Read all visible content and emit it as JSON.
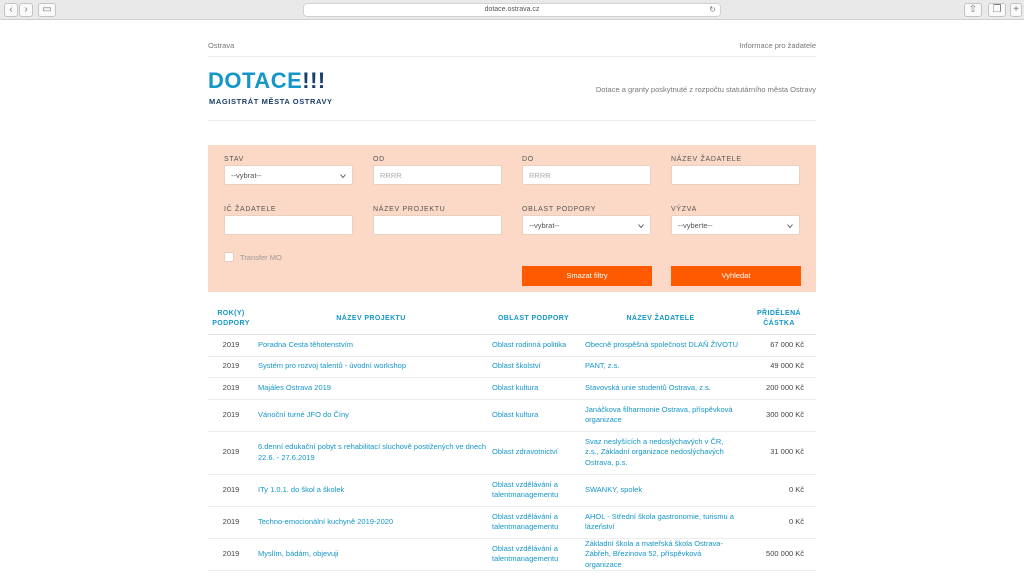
{
  "browser": {
    "url": "dotace.ostrava.cz"
  },
  "topbar": {
    "left": "Ostrava",
    "right": "Informace pro žadatele"
  },
  "header": {
    "logo_word": "DOTACE",
    "logo_bangs": "!!!",
    "logo_sub": "MAGISTRÁT MĚSTA OSTRAVY",
    "tagline": "Dotace a granty poskytnuté z rozpočtu statutárního města Ostravy"
  },
  "filters": {
    "stav": {
      "label": "STAV",
      "value": "--vybrat--"
    },
    "od": {
      "label": "OD",
      "placeholder": "RRRR"
    },
    "do": {
      "label": "DO",
      "placeholder": "RRRR"
    },
    "nazev_zadatele": {
      "label": "NÁZEV ŽADATELE",
      "value": ""
    },
    "ic_zadatele": {
      "label": "IČ ŽADATELE",
      "value": ""
    },
    "nazev_projektu": {
      "label": "NÁZEV PROJEKTU",
      "value": ""
    },
    "oblast_podpory": {
      "label": "OBLAST PODPORY",
      "value": "--vybrat--"
    },
    "vyzva": {
      "label": "VÝZVA",
      "value": "--vyberte--"
    },
    "transfer_label": "Transfer MO",
    "clear_label": "Smazat filtry",
    "search_label": "Vyhledat"
  },
  "table": {
    "headers": [
      "ROK(Y)\nPODPORY",
      "NÁZEV PROJEKTU",
      "OBLAST PODPORY",
      "NÁZEV ŽADATELE",
      "PŘIDĚLENÁ\nČÁSTKA"
    ],
    "rows": [
      {
        "year": "2019",
        "project": "Poradna Cesta těhotenstvím",
        "area": "Oblast rodinná politika",
        "applicant": "Obecně prospěšná společnost DLAŇ ŽIVOTU",
        "amount": "67 000 Kč"
      },
      {
        "year": "2019",
        "project": "Systém pro rozvoj talentů - úvodní workshop",
        "area": "Oblast školství",
        "applicant": "PANT, z.s.",
        "amount": "49 000 Kč"
      },
      {
        "year": "2019",
        "project": "Majáles Ostrava 2019",
        "area": "Oblast kultura",
        "applicant": "Stavovská unie studentů Ostrava, z.s.",
        "amount": "200 000 Kč"
      },
      {
        "year": "2019",
        "project": "Vánoční turné JFO do Číny",
        "area": "Oblast kultura",
        "applicant": "Janáčkova filharmonie Ostrava, příspěvková organizace",
        "amount": "300 000 Kč"
      },
      {
        "year": "2019",
        "project": "6.denní edukační pobyt s rehabilitací sluchově postižených ve dnech 22.6. - 27.6.2019",
        "area": "Oblast zdravotnictví",
        "applicant": "Svaz neslyšících a nedoslýchavých v ČR, z.s., Základní organizace nedoslýchavých Ostrava, p.s.",
        "amount": "31 000 Kč"
      },
      {
        "year": "2019",
        "project": "ITy 1.0.1. do škol a školek",
        "area": "Oblast vzdělávání a talentmanagementu",
        "applicant": "SWANKY, spolek",
        "amount": "0 Kč"
      },
      {
        "year": "2019",
        "project": "Techno-emocionální kuchyně 2019-2020",
        "area": "Oblast vzdělávání a talentmanagementu",
        "applicant": "AHOL - Střední škola gastronomie, turismu a lázeňství",
        "amount": "0 Kč"
      },
      {
        "year": "2019",
        "project": "Myslím, bádám, objevuji",
        "area": "Oblast vzdělávání a talentmanagementu",
        "applicant": "Základní škola a mateřská škola Ostrava-Zábřeh, Březinova 52, příspěvková organizace",
        "amount": "500 000 Kč"
      }
    ]
  }
}
